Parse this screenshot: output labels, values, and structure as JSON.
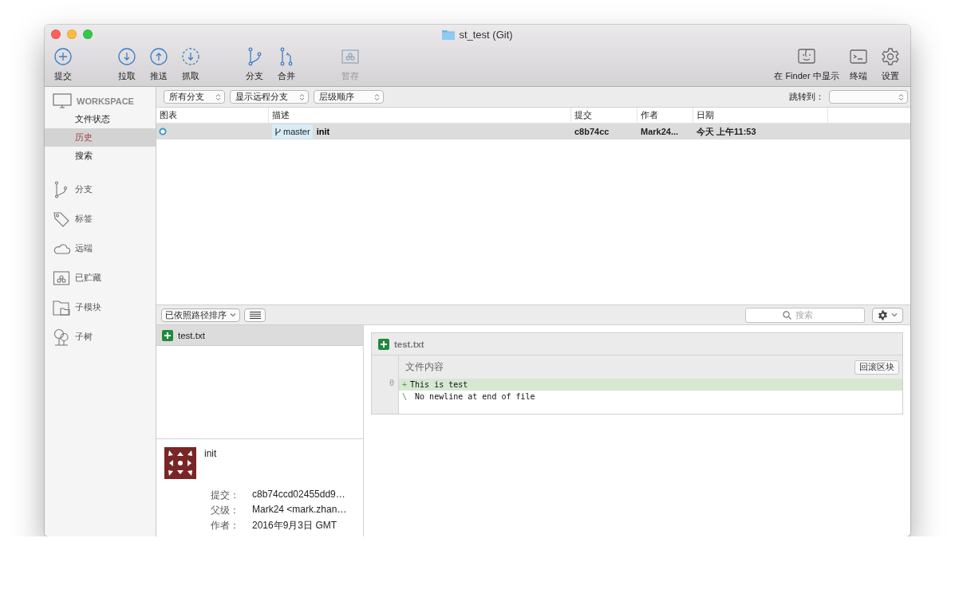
{
  "window": {
    "title": "st_test (Git)"
  },
  "toolbar": {
    "groups": [
      [
        {
          "kind": "commit",
          "label": "提交",
          "disabled": false
        }
      ],
      [
        {
          "kind": "pull",
          "label": "拉取",
          "disabled": false
        },
        {
          "kind": "push",
          "label": "推送",
          "disabled": false
        },
        {
          "kind": "fetch",
          "label": "抓取",
          "disabled": false
        }
      ],
      [
        {
          "kind": "branch",
          "label": "分支",
          "disabled": false
        },
        {
          "kind": "merge",
          "label": "合并",
          "disabled": false
        }
      ],
      [
        {
          "kind": "stash",
          "label": "暂存",
          "disabled": true
        }
      ]
    ],
    "right": [
      {
        "kind": "finder",
        "label": "在 Finder 中显示",
        "disabled": false
      },
      {
        "kind": "terminal",
        "label": "终端",
        "disabled": false
      },
      {
        "kind": "settings",
        "label": "设置",
        "disabled": false
      }
    ]
  },
  "sidebar": {
    "workspace": {
      "title": "WORKSPACE",
      "items": [
        {
          "label": "文件状态",
          "selected": false
        },
        {
          "label": "历史",
          "selected": true
        },
        {
          "label": "搜索",
          "selected": false
        }
      ]
    },
    "sections": [
      {
        "kind": "branches",
        "label": "分支"
      },
      {
        "kind": "tags",
        "label": "标签"
      },
      {
        "kind": "remotes",
        "label": "远端"
      },
      {
        "kind": "stashes",
        "label": "已贮藏"
      },
      {
        "kind": "submodules",
        "label": "子模块"
      },
      {
        "kind": "subtrees",
        "label": "子树"
      }
    ]
  },
  "filters": {
    "selects": [
      "所有分支",
      "显示远程分支",
      "层级顺序"
    ],
    "jump_label": "跳转到："
  },
  "table": {
    "columns": [
      "图表",
      "描述",
      "提交",
      "作者",
      "日期"
    ],
    "rows": [
      {
        "selected": true,
        "branch": "master",
        "description": "init",
        "commit": "c8b74cc",
        "author": "Mark24...",
        "date": "今天 上午11:53"
      }
    ]
  },
  "files_bar": {
    "sort": "已依照路径排序",
    "search": {
      "placeholder": "搜索"
    }
  },
  "files": [
    {
      "name": "test.txt",
      "selected": true
    }
  ],
  "commit_details": {
    "message": "init",
    "fields": [
      {
        "label": "提交：",
        "value": "c8b74ccd02455dd9…"
      },
      {
        "label": "父级：",
        "value": "Mark24 <mark.zhan…"
      },
      {
        "label": "作者：",
        "value": "2016年9月3日 GMT"
      }
    ]
  },
  "diff": {
    "file": "test.txt",
    "hunk": {
      "title": "文件内容",
      "button": "回滚区块"
    },
    "lines": [
      {
        "kind": "added",
        "number": "0",
        "marker": "+",
        "text": "This is test"
      },
      {
        "kind": "note",
        "marker": "\\",
        "text": " No newline at end of file"
      }
    ]
  }
}
